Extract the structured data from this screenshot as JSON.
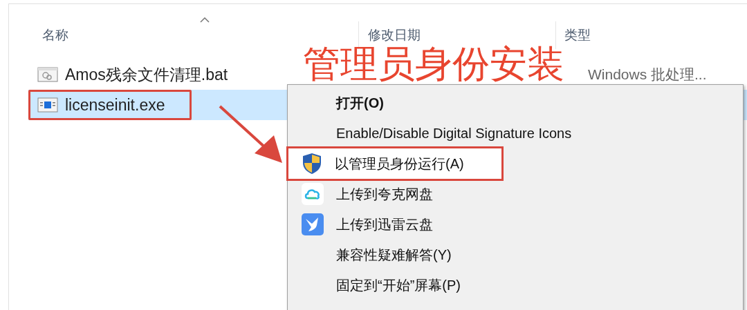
{
  "columns": [
    {
      "label": "名称",
      "sorted": true
    },
    {
      "label": "修改日期",
      "sorted": false
    },
    {
      "label": "类型",
      "sorted": false
    }
  ],
  "files": [
    {
      "name": "Amos残余文件清理.bat",
      "type": "Windows 批处理...",
      "kind": "bat",
      "selected": false,
      "boxed": false
    },
    {
      "name": "licenseinit.exe",
      "kind": "exe",
      "selected": true,
      "boxed": true
    }
  ],
  "annotation": {
    "title": "管理员身份安装"
  },
  "menu": {
    "items": [
      {
        "label": "打开(O)",
        "kind": "plain",
        "default": true,
        "hovered": false,
        "boxed": false
      },
      {
        "label": "Enable/Disable Digital Signature Icons",
        "kind": "plain",
        "default": false,
        "hovered": false,
        "boxed": false
      },
      {
        "label": "以管理员身份运行(A)",
        "kind": "shield",
        "default": false,
        "hovered": true,
        "boxed": true
      },
      {
        "label": "上传到夸克网盘",
        "kind": "cloud",
        "default": false,
        "hovered": false,
        "boxed": false
      },
      {
        "label": "上传到迅雷云盘",
        "kind": "bird",
        "default": false,
        "hovered": false,
        "boxed": false
      },
      {
        "label": "兼容性疑难解答(Y)",
        "kind": "plain",
        "default": false,
        "hovered": false,
        "boxed": false
      },
      {
        "label": "固定到“开始”屏幕(P)",
        "kind": "plain",
        "default": false,
        "hovered": false,
        "boxed": false
      }
    ]
  }
}
